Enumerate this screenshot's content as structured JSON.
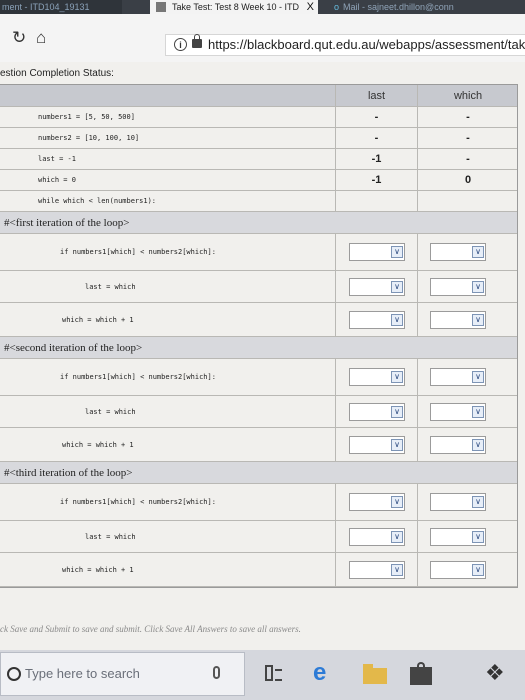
{
  "browser": {
    "tabs": [
      {
        "title": "ment - ITD104_19131"
      },
      {
        "title": "Take Test: Test 8 Week 10 - ITD",
        "close": "X"
      },
      {
        "title": "Mail - sajneet.dhillon@conn"
      }
    ],
    "url": "https://blackboard.qut.edu.au/webapps/assessment/tak"
  },
  "page": {
    "status_label": "estion Completion Status:",
    "columns": [
      "last",
      "which"
    ],
    "init_rows": [
      {
        "code": "numbers1 = [5,  50, 500]",
        "last": "-",
        "which": "-"
      },
      {
        "code": "numbers2 = [10, 100, 10]",
        "last": "-",
        "which": "-"
      },
      {
        "code": "last = -1",
        "last": "-1",
        "which": "-"
      },
      {
        "code": "which = 0",
        "last": "-1",
        "which": "0"
      },
      {
        "code": "while which < len(numbers1):",
        "last": "",
        "which": ""
      }
    ],
    "iterations": [
      {
        "label": "#<first iteration of the loop>",
        "rows": [
          {
            "code": "if numbers1[which] < numbers2[which]:"
          },
          {
            "code": "last = which"
          },
          {
            "code": "which = which + 1"
          }
        ]
      },
      {
        "label": "#<second iteration of the loop>",
        "rows": [
          {
            "code": "if numbers1[which] < numbers2[which]:"
          },
          {
            "code": "last = which"
          },
          {
            "code": "which = which + 1"
          }
        ]
      },
      {
        "label": "#<third iteration of the loop>",
        "rows": [
          {
            "code": "if numbers1[which] < numbers2[which]:"
          },
          {
            "code": "last = which"
          },
          {
            "code": "which = which + 1"
          }
        ]
      }
    ],
    "footnote": "ck Save and Submit to save and submit. Click Save All Answers to save all answers."
  },
  "taskbar": {
    "search_placeholder": "Type here to search",
    "icons": [
      "search-icon",
      "microphone-icon",
      "task-view-icon",
      "edge-icon",
      "file-explorer-icon",
      "store-icon",
      "dropbox-icon"
    ]
  },
  "colors": {
    "header_bg": "#c7c9cf",
    "section_bg": "#d8d9dd",
    "select_arrow": "#2d4b80"
  }
}
